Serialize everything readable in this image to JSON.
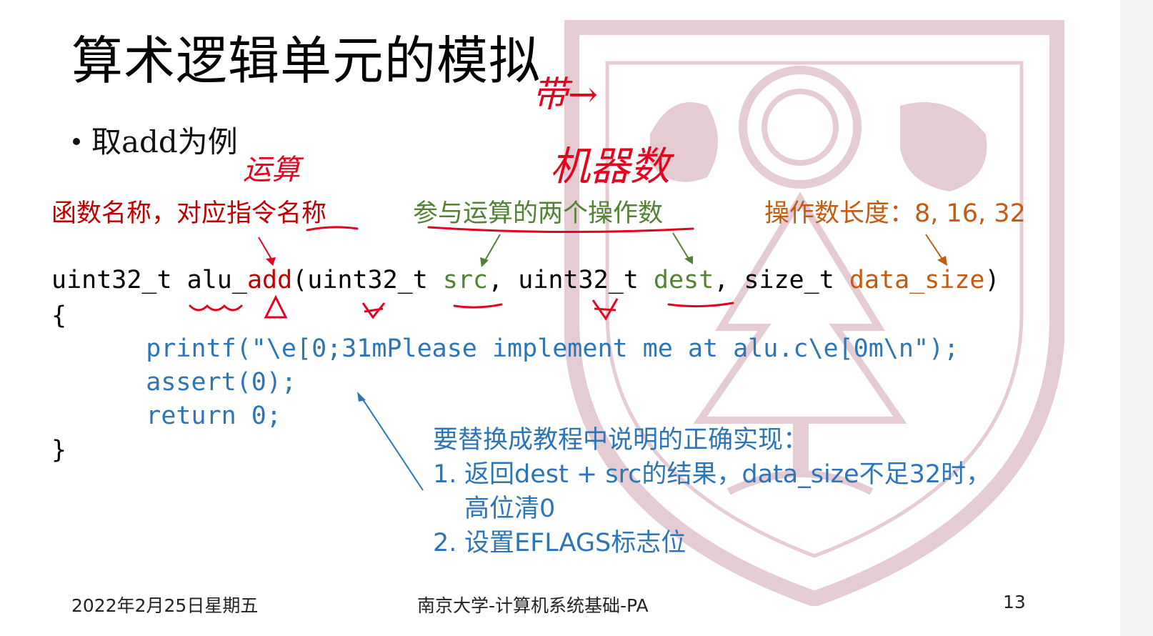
{
  "slide": {
    "title": "算术逻辑单元的模拟",
    "bullet": "取add为例"
  },
  "labels": {
    "function_name": "函数名称，对应指令名称",
    "operands": "参与运算的两个操作数",
    "operand_size": "操作数长度：8, 16, 32"
  },
  "code": {
    "sig_type": "uint32_t ",
    "sig_prefix": "alu_",
    "sig_name": "add",
    "sig_open": "(uint32_t ",
    "sig_src": "src",
    "sig_mid": ", uint32_t ",
    "sig_dest": "dest",
    "sig_mid2": ", size_t ",
    "sig_size": "data_size",
    "sig_close": ")",
    "open_brace": "{",
    "line1": "    printf(\"\\e[0;31mPlease implement me at alu.c\\e[0m\\n\");",
    "line2": "    assert(0);",
    "line3": "    return 0;",
    "close_brace": "}"
  },
  "note": {
    "header": "要替换成教程中说明的正确实现：",
    "item1_num": "1.",
    "item1_line1": "返回dest + src的结果，data_size不足32时，",
    "item1_line2": "高位清0",
    "item2_num": "2.",
    "item2": "设置EFLAGS标志位"
  },
  "handwriting": {
    "carry": "带→",
    "random": "机器数",
    "compute": "运算"
  },
  "footer": {
    "date": "2022年2月25日星期五",
    "course": "南京大学-计算机系统基础-PA",
    "page": "13"
  },
  "colors": {
    "function_label": "#c00000",
    "operands_label": "#548235",
    "size_label": "#c55a11",
    "code_body": "#2e75b6",
    "note": "#2e75b6",
    "handwriting": "#e0061f",
    "watermark": "#8b1c3b"
  }
}
